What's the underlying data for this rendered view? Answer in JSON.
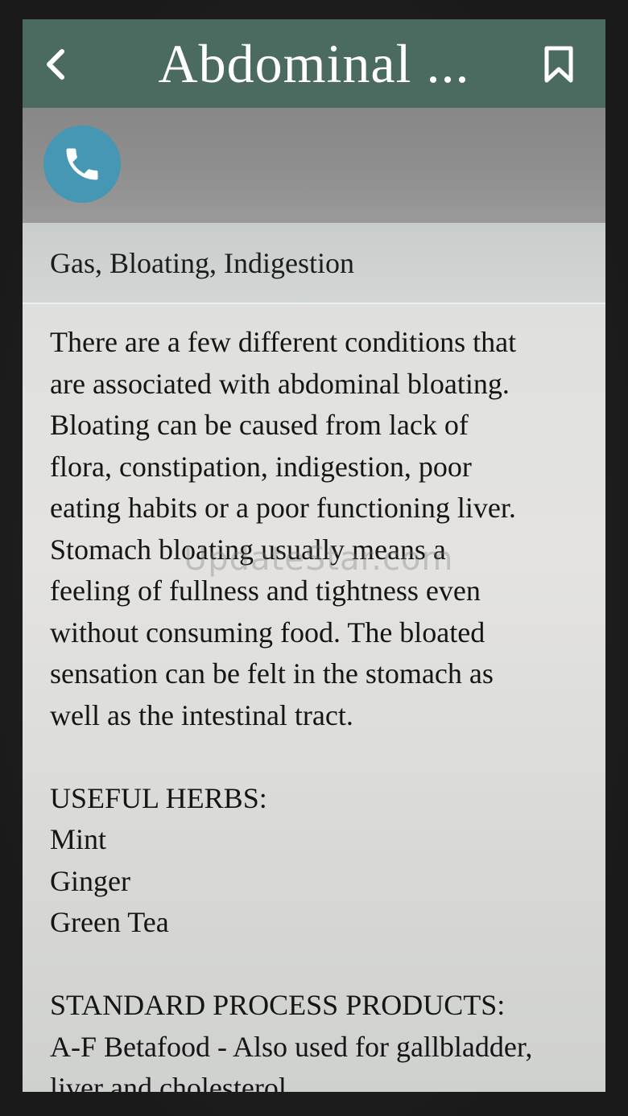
{
  "header": {
    "title": "Abdominal ...",
    "back_icon": "chevron-left-icon",
    "bookmark_icon": "bookmark-icon"
  },
  "actions": {
    "call_icon": "phone-icon",
    "call_color": "#4597b3"
  },
  "section": {
    "subtitle": "Gas, Bloating, Indigestion"
  },
  "article": {
    "body_lines": [
      "There are a few different conditions that",
      "are associated with abdominal bloating.",
      "Bloating can be caused from lack of",
      "flora, constipation, indigestion, poor",
      "eating habits or a poor functioning liver.",
      "Stomach bloating usually means a",
      "feeling of fullness and tightness even",
      "without consuming food. The bloated",
      "sensation can be felt in the stomach as",
      "well as the intestinal tract."
    ],
    "herbs_heading": "USEFUL HERBS:",
    "herbs": [
      "Mint",
      "Ginger",
      "Green Tea"
    ],
    "products_heading": "STANDARD PROCESS PRODUCTS:",
    "products_lines": [
      "A-F Betafood - Also used for gallbladder,",
      "liver and cholesterol"
    ]
  },
  "watermark": "UpdateStar.com",
  "colors": {
    "header_bg": "#4b6b61",
    "action_bar_bg": "#8e8e8e",
    "text": "#151515"
  }
}
